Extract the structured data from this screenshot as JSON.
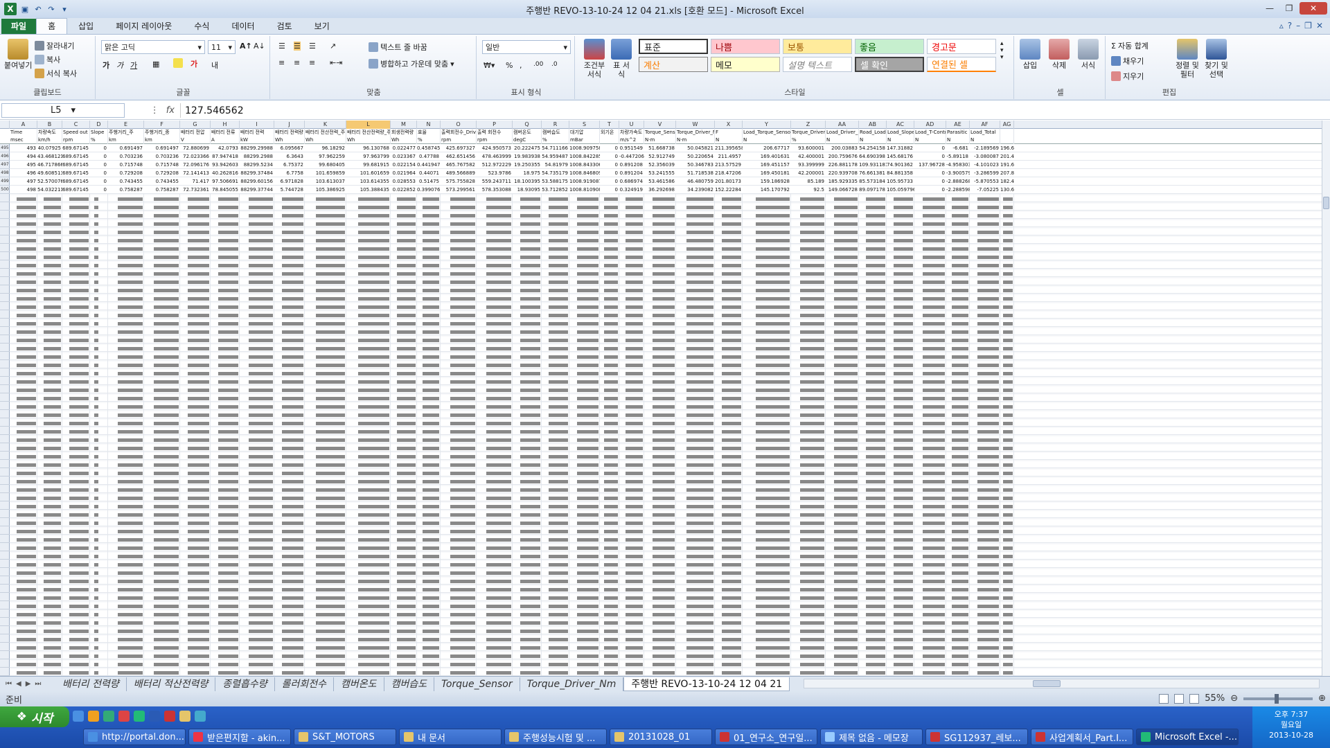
{
  "window": {
    "title": "주행반 REVO-13-10-24 12 04 21.xls [호환 모드] - Microsoft Excel"
  },
  "ribbon_tabs": [
    "파일",
    "홈",
    "삽입",
    "페이지 레이아웃",
    "수식",
    "데이터",
    "검토",
    "보기"
  ],
  "clipboard": {
    "paste": "붙여넣기",
    "cut": "잘라내기",
    "copy": "복사",
    "format_painter": "서식 복사",
    "label": "클립보드"
  },
  "font": {
    "name": "맑은 고딕",
    "size": "11",
    "label": "글꼴"
  },
  "alignment": {
    "wrap": "텍스트 줄 바꿈",
    "merge": "병합하고 가운데 맞춤",
    "label": "맞춤"
  },
  "number": {
    "format": "일반",
    "label": "표시 형식"
  },
  "styles": {
    "conditional": "조건부 서식",
    "table": "표 서식",
    "cells": [
      "표준",
      "나쁨",
      "보통",
      "좋음",
      "경고문",
      "계산",
      "메모",
      "설명 텍스트",
      "셀 확인",
      "연결된 셀"
    ],
    "label": "스타일"
  },
  "cells": {
    "insert": "삽입",
    "delete": "삭제",
    "format": "서식",
    "label": "셀"
  },
  "editing": {
    "autosum": "자동 합계",
    "fill": "채우기",
    "clear": "지우기",
    "sort": "정렬 및 필터",
    "find": "찾기 및 선택",
    "label": "편집"
  },
  "formula_bar": {
    "name_box": "L5",
    "fx": "fx",
    "value": "127.546562"
  },
  "columns": [
    "A",
    "B",
    "C",
    "D",
    "E",
    "F",
    "G",
    "H",
    "I",
    "J",
    "K",
    "L",
    "M",
    "N",
    "O",
    "P",
    "Q",
    "R",
    "S",
    "T",
    "U",
    "V",
    "W",
    "X",
    "Y",
    "Z",
    "AA",
    "AB",
    "AC",
    "AD",
    "AE",
    "AF",
    "AG"
  ],
  "header_row1": [
    "Time",
    "차량속도",
    "Speed out",
    "Slope",
    "주행거리_주",
    "주행거리_종",
    "배터리 전압",
    "배터리 전류",
    "배터리 전력",
    "배터리 전력량",
    "배터리 전산전력_주",
    "배터리 전산전력량_주",
    "회생전력량",
    "효율",
    "출력회전수_Driver",
    "출력 회전수",
    "캠버온도",
    "캠버습도",
    "대기압",
    "외기온",
    "차량가속도",
    "Torque_Sensor",
    "Torque_Driver_Nm",
    "F",
    "Load_Torque_Sensor_N",
    "Torque_Driver",
    "Load_Driver_N",
    "Road_Load",
    "Load_Slope",
    "Load_T-Control",
    "Parasitic L",
    "Load_Total",
    ""
  ],
  "header_row2": [
    "msec",
    "km/h",
    "rpm",
    "%",
    "km",
    "km",
    "V",
    "A",
    "kW",
    "Wh",
    "Wh",
    "Wh",
    "Wh",
    "%",
    "rpm",
    "rpm",
    "degC",
    "%",
    "mBar",
    "",
    "m/s^2",
    "N·m",
    "N·m",
    "N",
    "N",
    "%",
    "N",
    "N",
    "N",
    "N",
    "N",
    "N",
    ""
  ],
  "row_numbers": [
    "1",
    "2",
    "495",
    "496",
    "497",
    "498",
    "499",
    "500"
  ],
  "first_rows": [
    [
      "493",
      "40.07925",
      "689.67145",
      "0",
      "0.691497",
      "0.691497",
      "72.880699",
      "42.0793",
      "88299.29988",
      "6.095667",
      "96.18292",
      "96.130768",
      "0.022477",
      "0.458745",
      "425.697327",
      "424.950573",
      "20.222475",
      "54.711166",
      "1008.909758",
      "0",
      "0.951549",
      "51.668738",
      "50.045821",
      "211.395658",
      "206.67717",
      "93.600001",
      "200.03883",
      "54.254158",
      "147.31882",
      "0",
      "-6.681",
      "-2.189569",
      "196.693288"
    ],
    [
      "494",
      "43.468121",
      "689.67145",
      "0",
      "0.703236",
      "0.703236",
      "72.023366",
      "87.947418",
      "88299.2988",
      "6.3643",
      "97.962259",
      "97.963799",
      "0.023367",
      "0.47788",
      "462.651456",
      "478.463999",
      "19.983938",
      "54.959487",
      "1008.842285",
      "0",
      "-0.447206",
      "52.912749",
      "50.220654",
      "211.4957",
      "169.401631",
      "42.400001",
      "200.759676",
      "64.690398",
      "145.68176",
      "0",
      "-5.89118",
      "-3.080087",
      "201.416757"
    ],
    [
      "495",
      "46.717866",
      "689.67145",
      "0",
      "0.715748",
      "0.715748",
      "72.096176",
      "93.942603",
      "88299.5234",
      "6.75372",
      "99.680405",
      "99.681915",
      "0.022154",
      "0.441947",
      "465.767582",
      "512.972229",
      "19.250355",
      "54.81979",
      "1008.843306",
      "0",
      "0.891208",
      "52.356039",
      "50.346783",
      "213.57529",
      "169.451157",
      "93.399999",
      "226.881178",
      "109.931181",
      "74.901362",
      "137.96728",
      "-4.958303",
      "-4.101023",
      "191.614005"
    ],
    [
      "496",
      "49.608513",
      "689.67145",
      "0",
      "0.729208",
      "0.729208",
      "72.141413",
      "40.262816",
      "88299.37484",
      "6.7758",
      "101.659859",
      "101.601659",
      "0.021964",
      "0.44071",
      "489.566889",
      "523.9786",
      "18.975",
      "54.735179",
      "1008.846809",
      "0",
      "0.891204",
      "53.241555",
      "51.718538",
      "218.47206",
      "169.450181",
      "42.200001",
      "220.939708",
      "76.661381",
      "84.881358",
      "0",
      "-3.900579",
      "-3.286599",
      "207.845893"
    ],
    [
      "497",
      "52.570076",
      "689.67145",
      "0",
      "0.743455",
      "0.743455",
      "71.417",
      "97.506691",
      "88299.60156",
      "6.971828",
      "103.613037",
      "103.614355",
      "0.028553",
      "0.51475",
      "575.755828",
      "559.243711",
      "18.100395",
      "53.588175",
      "1008.919087",
      "0",
      "0.686974",
      "53.461586",
      "46.480759",
      "201.80173",
      "159.186928",
      "85.189",
      "185.929335",
      "85.573184",
      "105.95733",
      "0",
      "-2.888268",
      "-5.870553",
      "182.461678"
    ],
    [
      "498",
      "54.032211",
      "689.67145",
      "0",
      "0.758287",
      "0.758287",
      "72.732361",
      "78.845055",
      "88299.37744",
      "5.744728",
      "105.386925",
      "105.388435",
      "0.022852",
      "0.399076",
      "573.299561",
      "578.353088",
      "18.93095",
      "53.712852",
      "1008.810908",
      "0",
      "0.324919",
      "36.292698",
      "34.239082",
      "152.22284",
      "145.170792",
      "92.5",
      "149.066728",
      "89.097178",
      "105.059796",
      "0",
      "-2.288598",
      "-7.05225",
      "130.666574"
    ]
  ],
  "sheet_tabs": [
    "배터리 전력량",
    "배터리 적산전력량",
    "종렬흡수량",
    "롤러회전수",
    "캠버온도",
    "캠버습도",
    "Torque_Sensor",
    "Torque_Driver_Nm",
    "주행반 REVO-13-10-24 12 04 21"
  ],
  "status": {
    "ready": "준비",
    "zoom": "55%"
  },
  "taskbar": {
    "start": "시작",
    "items": [
      "http://portal.don...",
      "받은편지함 - akin...",
      "S&T_MOTORS",
      "내 문서",
      "주행성능시험 및 ...",
      "20131028_01",
      "01_연구소_연구일...",
      "제목 없음 - 메모장",
      "SG112937_레보...",
      "사업계획서_Part.I...",
      "Microsoft Excel -..."
    ],
    "time": "오후 7:37",
    "day": "월요일",
    "date": "2013-10-28"
  },
  "colors": {
    "excel_green": "#1f7a3c",
    "selected_col": "#f5c973",
    "taskbar_blue": "#1a4aa8"
  }
}
